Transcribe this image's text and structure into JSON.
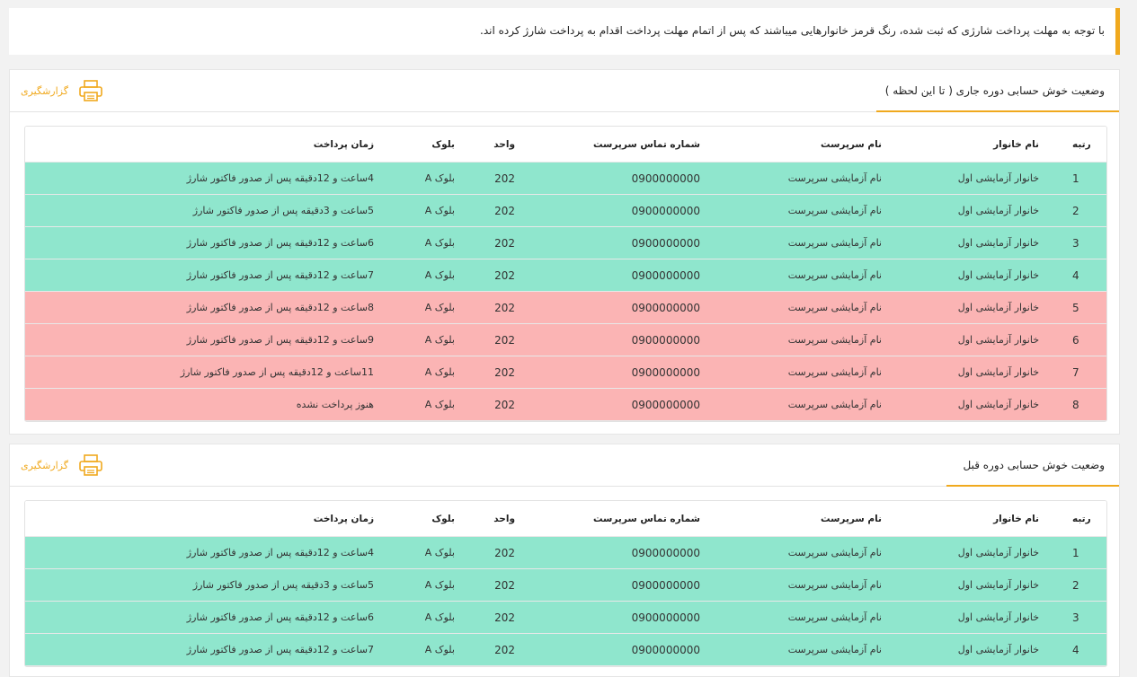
{
  "notice": "با توجه به مهلت پرداخت شارژی که ثبت شده، رنگ قرمز خانوارهایی میباشند که پس از اتمام مهلت پرداخت اقدام به پرداخت شارژ کرده اند.",
  "report_label": "گزارشگیری",
  "colors": {
    "accent": "#f0a91e",
    "paid_row": "#8fe6cd",
    "late_row": "#fbb4b4"
  },
  "columns": {
    "rank": "رتبه",
    "family": "نام خانوار",
    "owner": "نام سرپرست",
    "phone": "شماره تماس سرپرست",
    "unit": "واحد",
    "block": "بلوک",
    "time": "زمان پرداخت"
  },
  "current": {
    "title": "وضعیت خوش حسابی دوره جاری ( تا این لحظه )",
    "rows": [
      {
        "rank": "1",
        "family": "خانوار آزمایشی اول",
        "owner": "نام آزمایشی سرپرست",
        "phone": "0900000000",
        "unit": "202",
        "block": "بلوک A",
        "time": "4ساعت و 12دقیقه پس از صدور فاکتور شارژ",
        "status": "paid"
      },
      {
        "rank": "2",
        "family": "خانوار آزمایشی اول",
        "owner": "نام آزمایشی سرپرست",
        "phone": "0900000000",
        "unit": "202",
        "block": "بلوک A",
        "time": "5ساعت و 3دقیقه پس از صدور فاکتور شارژ",
        "status": "paid"
      },
      {
        "rank": "3",
        "family": "خانوار آزمایشی اول",
        "owner": "نام آزمایشی سرپرست",
        "phone": "0900000000",
        "unit": "202",
        "block": "بلوک A",
        "time": "6ساعت و 12دقیقه پس از صدور فاکتور شارژ",
        "status": "paid"
      },
      {
        "rank": "4",
        "family": "خانوار آزمایشی اول",
        "owner": "نام آزمایشی سرپرست",
        "phone": "0900000000",
        "unit": "202",
        "block": "بلوک A",
        "time": "7ساعت و 12دقیقه پس از صدور فاکتور شارژ",
        "status": "paid"
      },
      {
        "rank": "5",
        "family": "خانوار آزمایشی اول",
        "owner": "نام آزمایشی سرپرست",
        "phone": "0900000000",
        "unit": "202",
        "block": "بلوک A",
        "time": "8ساعت و 12دقیقه پس از صدور فاکتور شارژ",
        "status": "late"
      },
      {
        "rank": "6",
        "family": "خانوار آزمایشی اول",
        "owner": "نام آزمایشی سرپرست",
        "phone": "0900000000",
        "unit": "202",
        "block": "بلوک A",
        "time": "9ساعت و 12دقیقه پس از صدور فاکتور شارژ",
        "status": "late"
      },
      {
        "rank": "7",
        "family": "خانوار آزمایشی اول",
        "owner": "نام آزمایشی سرپرست",
        "phone": "0900000000",
        "unit": "202",
        "block": "بلوک A",
        "time": "11ساعت و 12دقیقه پس از صدور فاکتور شارژ",
        "status": "late"
      },
      {
        "rank": "8",
        "family": "خانوار آزمایشی اول",
        "owner": "نام آزمایشی سرپرست",
        "phone": "0900000000",
        "unit": "202",
        "block": "بلوک A",
        "time": "هنوز پرداخت نشده",
        "status": "late"
      }
    ]
  },
  "previous": {
    "title": "وضعیت خوش حسابی دوره قبل",
    "rows": [
      {
        "rank": "1",
        "family": "خانوار آزمایشی اول",
        "owner": "نام آزمایشی سرپرست",
        "phone": "0900000000",
        "unit": "202",
        "block": "بلوک A",
        "time": "4ساعت و 12دقیقه پس از صدور فاکتور شارژ",
        "status": "paid"
      },
      {
        "rank": "2",
        "family": "خانوار آزمایشی اول",
        "owner": "نام آزمایشی سرپرست",
        "phone": "0900000000",
        "unit": "202",
        "block": "بلوک A",
        "time": "5ساعت و 3دقیقه پس از صدور فاکتور شارژ",
        "status": "paid"
      },
      {
        "rank": "3",
        "family": "خانوار آزمایشی اول",
        "owner": "نام آزمایشی سرپرست",
        "phone": "0900000000",
        "unit": "202",
        "block": "بلوک A",
        "time": "6ساعت و 12دقیقه پس از صدور فاکتور شارژ",
        "status": "paid"
      },
      {
        "rank": "4",
        "family": "خانوار آزمایشی اول",
        "owner": "نام آزمایشی سرپرست",
        "phone": "0900000000",
        "unit": "202",
        "block": "بلوک A",
        "time": "7ساعت و 12دقیقه پس از صدور فاکتور شارژ",
        "status": "paid"
      }
    ]
  }
}
